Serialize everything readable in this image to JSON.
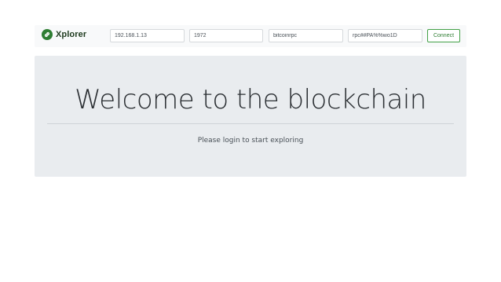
{
  "navbar": {
    "brand": "Xplorer",
    "brand_icon": "link-icon",
    "brand_color": "#2e7d32",
    "host_value": "192.168.1.13",
    "port_value": "1972",
    "user_value": "bitcoinrpc",
    "password_value": "rpc##PA%%wo1D",
    "connect_label": "Connect"
  },
  "hero": {
    "title": "Welcome to the blockchain",
    "lead": "Please login to start exploring"
  }
}
